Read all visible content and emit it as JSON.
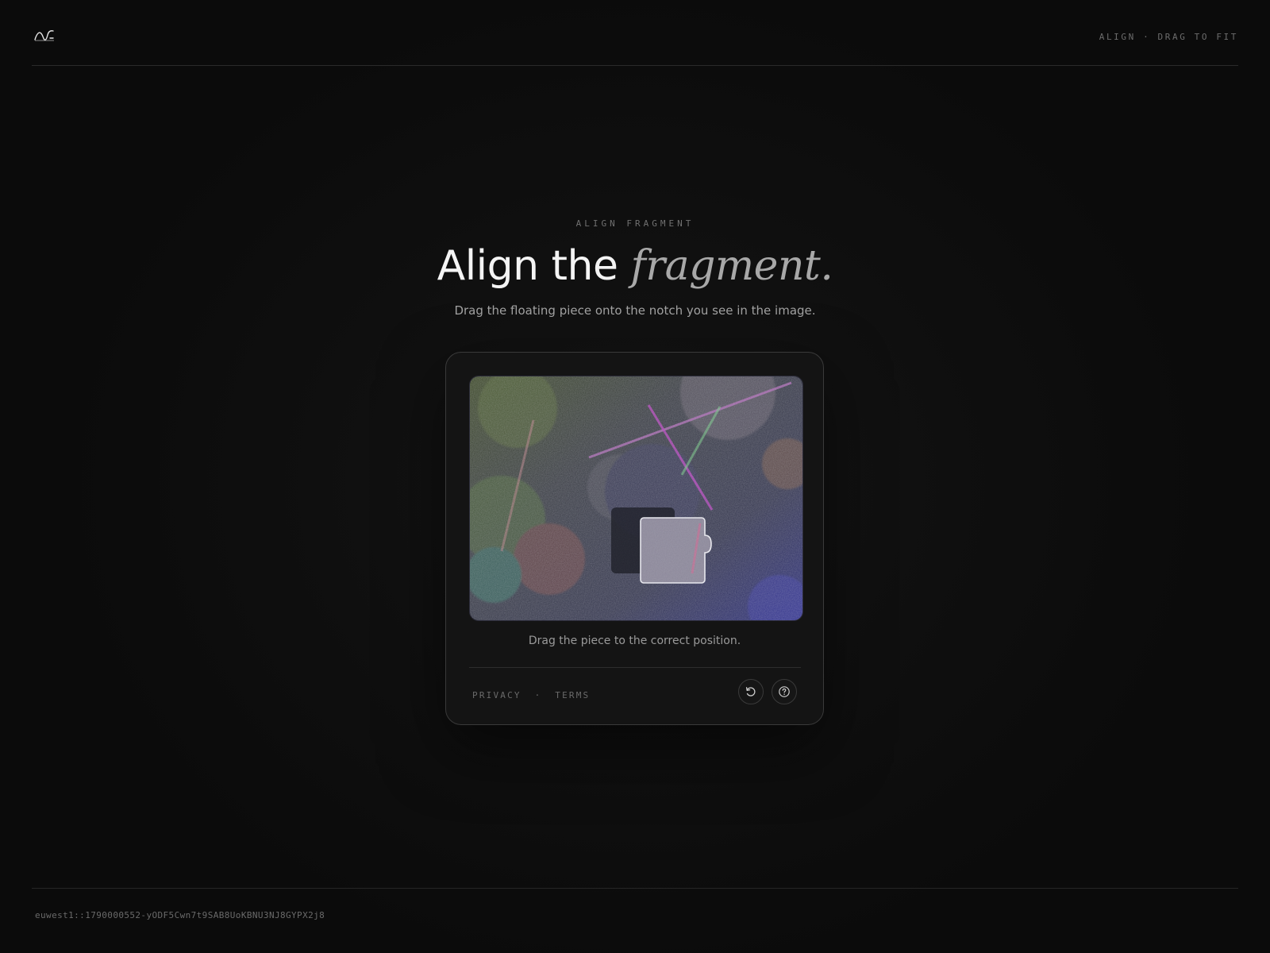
{
  "header": {
    "tag_left": "ALIGN",
    "tag_separator": "·",
    "tag_right": "DRAG TO FIT",
    "logo_icon": "wave-logo-icon"
  },
  "hero": {
    "eyebrow": "ALIGN FRAGMENT",
    "title_main": "Align the ",
    "title_accent": "fragment.",
    "subtitle": "Drag the floating piece onto the notch you see in the image."
  },
  "card": {
    "instruction": "Drag the piece to the correct position.",
    "privacy_label": "PRIVACY",
    "links_separator": "·",
    "terms_label": "TERMS",
    "refresh_icon": "refresh-icon",
    "help_icon": "help-icon"
  },
  "footer": {
    "session_id": "euwest1::1790000552-yODF5Cwn7t9SAB8UoKBNU3NJ8GYPX2j8"
  },
  "colors": {
    "background": "#0b0b0b",
    "card_background": "#141414",
    "text_primary": "#f4f4f4",
    "text_muted": "#a2a2a2",
    "accent_italic": "#a8a8a8"
  }
}
